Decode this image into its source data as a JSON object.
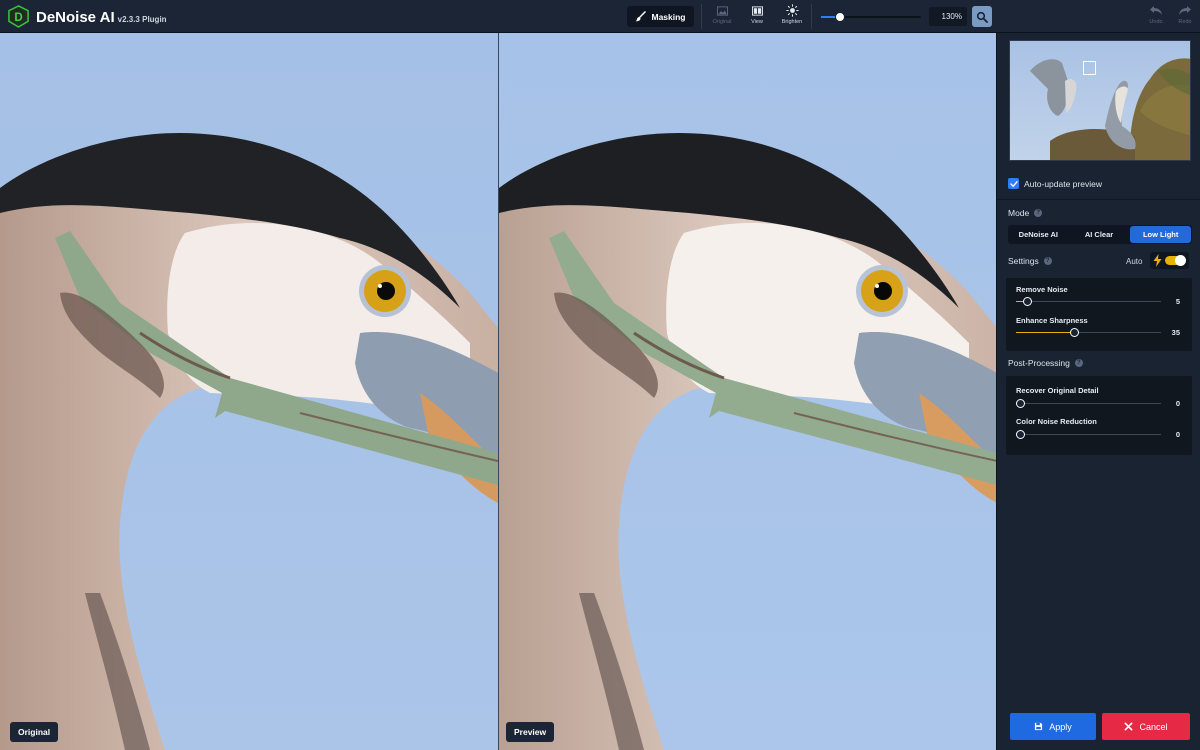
{
  "app": {
    "title": "DeNoise AI",
    "version": "v2.3.3 Plugin"
  },
  "toolbar": {
    "masking_label": "Masking",
    "original_label": "Original",
    "view_label": "View",
    "brighten_label": "Brighten",
    "zoom_value": "130%",
    "zoom_slider_fraction": 0.19,
    "undo_label": "Undo",
    "redo_label": "Redo"
  },
  "canvas": {
    "left_label": "Original",
    "right_label": "Preview"
  },
  "panel": {
    "auto_update_label": "Auto-update preview",
    "auto_update_checked": true,
    "mode_heading": "Mode",
    "modes": [
      "DeNoise AI",
      "AI Clear",
      "Low Light"
    ],
    "active_mode": "Low Light",
    "settings_heading": "Settings",
    "auto_label": "Auto",
    "auto_enabled": true,
    "sliders": [
      {
        "label": "Remove Noise",
        "value": "5",
        "fraction": 0.05
      },
      {
        "label": "Enhance Sharpness",
        "value": "35",
        "fraction": 0.37
      }
    ],
    "post_heading": "Post-Processing",
    "post_sliders": [
      {
        "label": "Recover Original Detail",
        "value": "0",
        "fraction": 0.0
      },
      {
        "label": "Color Noise Reduction",
        "value": "0",
        "fraction": 0.0
      }
    ],
    "apply_label": "Apply",
    "cancel_label": "Cancel"
  },
  "colors": {
    "accent_blue": "#2469d8",
    "slider_yellow": "#e5b400",
    "cancel_red": "#e62a45",
    "sky": "#a9c3e8"
  },
  "icons": {
    "logo": "denoise-logo-icon",
    "masking": "brush-icon",
    "original": "image-icon",
    "view": "split-view-icon",
    "brighten": "sun-icon",
    "zoom": "magnifier-icon",
    "undo": "undo-arrow-icon",
    "redo": "redo-arrow-icon",
    "auto": "lightning-icon",
    "apply": "save-icon",
    "cancel": "x-icon"
  }
}
